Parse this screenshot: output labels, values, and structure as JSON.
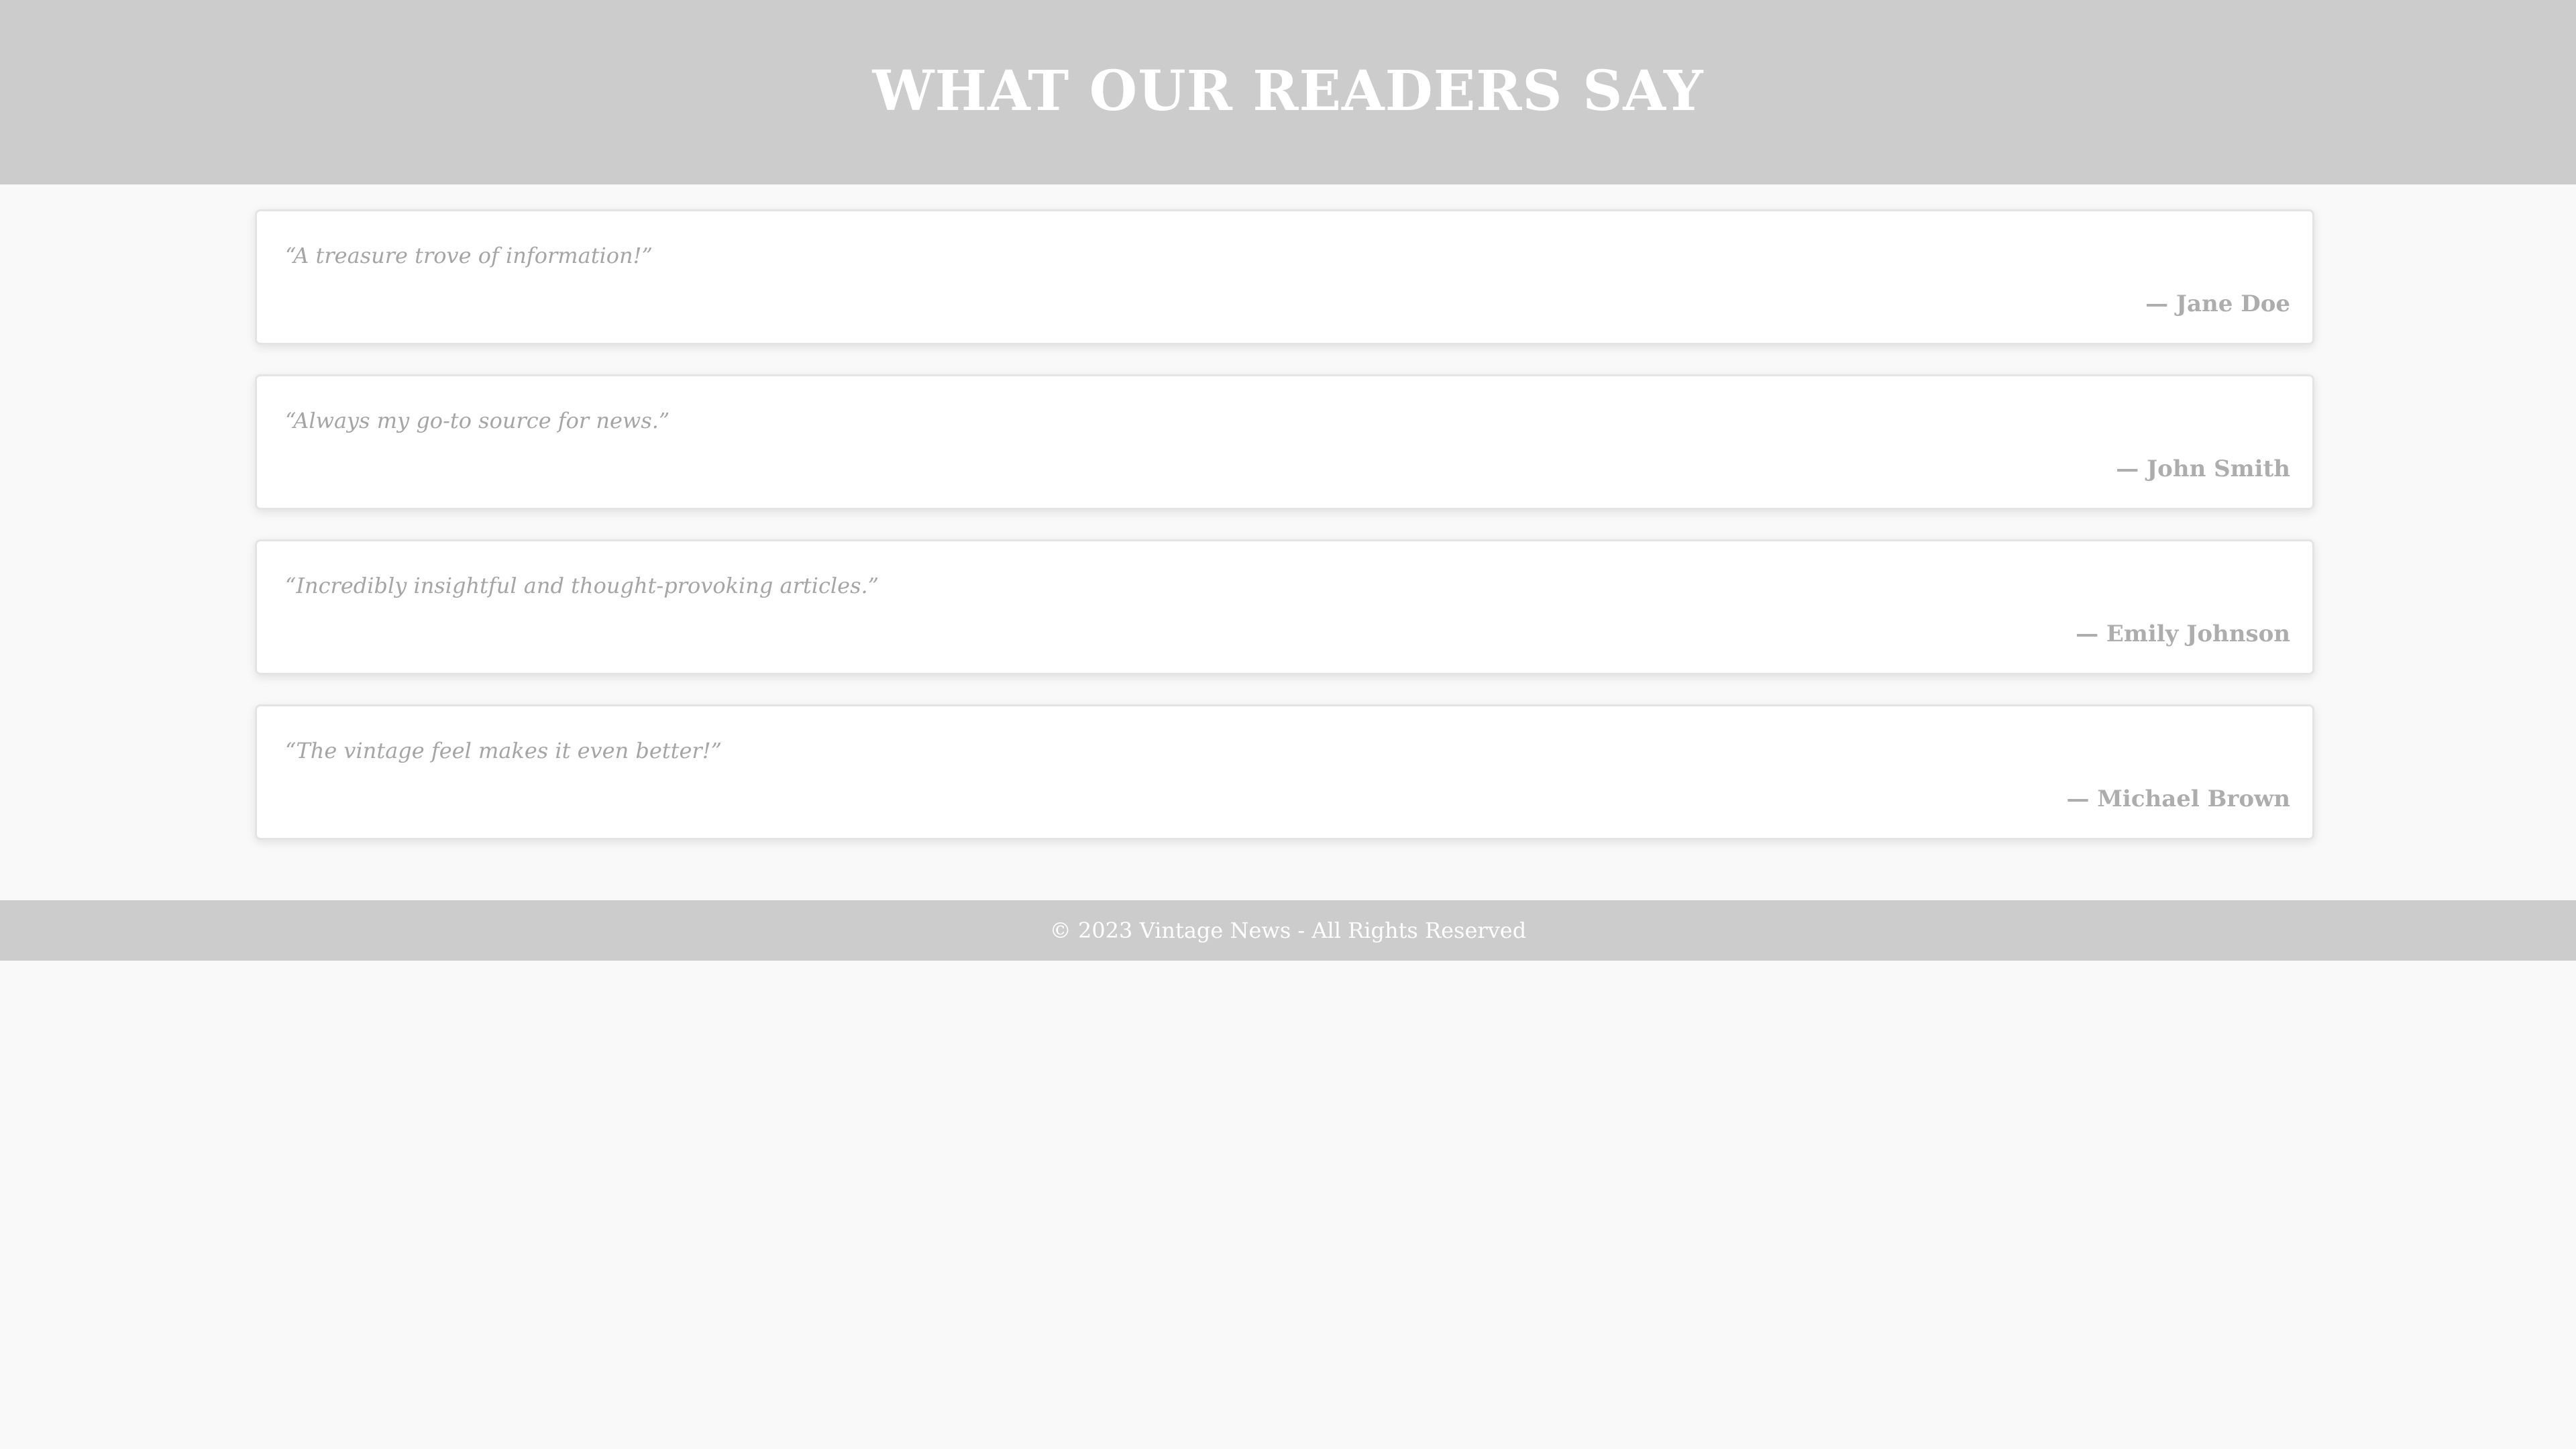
{
  "header": {
    "title": "WHAT OUR READERS SAY"
  },
  "testimonials": [
    {
      "quote": "“A treasure trove of information!”",
      "author": "— Jane Doe"
    },
    {
      "quote": "“Always my go-to source for news.”",
      "author": "— John Smith"
    },
    {
      "quote": "“Incredibly insightful and thought-provoking articles.”",
      "author": "— Emily Johnson"
    },
    {
      "quote": "“The vintage feel makes it even better!”",
      "author": "— Michael Brown"
    }
  ],
  "footer": {
    "text": "© 2023 Vintage News - All Rights Reserved"
  },
  "colors": {
    "header_bg": "#cccccc",
    "page_bg": "#f9f9f9",
    "card_bg": "#ffffff",
    "text_muted": "#a5a5a5"
  }
}
